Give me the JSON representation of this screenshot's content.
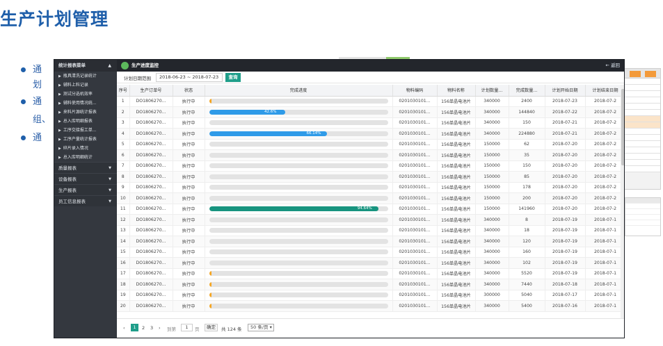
{
  "slide": {
    "title": "生产计划管理",
    "bullets": [
      {
        "prefix": "通"
      },
      {
        "prefix": "划"
      },
      {
        "prefix": "通"
      },
      {
        "prefix": "组、"
      },
      {
        "prefix": "通"
      }
    ]
  },
  "sidebar": {
    "header": "统计报表菜单",
    "items": [
      "瓶具清洗记录统计",
      "辅料上料记录",
      "测试分选机效率",
      "辅料使用情况统...",
      "来料片源统计报表",
      "总入库明细报表",
      "工序交接报工单...",
      "工序产量统计报表",
      "碎片录入情况",
      "总入库明细统计"
    ],
    "groups": [
      "质量报表",
      "设备报表",
      "生产报表",
      "员工信息报表"
    ]
  },
  "topbar": {
    "title": "生产进度监控",
    "back": "← 返回"
  },
  "filter": {
    "label": "计划日期范围",
    "range": "2018-06-23 ~ 2018-07-23",
    "button": "查询"
  },
  "table": {
    "columns": [
      "序号",
      "生产订单号",
      "状态",
      "完成进度",
      "物料编码",
      "物料名称",
      "计划数量...",
      "完成数量...",
      "计划开始日期",
      "计划结束日期"
    ],
    "rows": [
      {
        "no": "1",
        "order": "DO1806270...",
        "status": "执行中",
        "progress": 0.7,
        "progress_label": "",
        "material_code": "0201030101...",
        "material_name": "156单晶电池片",
        "plan_qty": "340000",
        "done_qty": "2400",
        "start": "2018-07-23",
        "end": "2018-07-2"
      },
      {
        "no": "2",
        "order": "DO1806270...",
        "status": "执行中",
        "progress": 42.6,
        "progress_label": "42.6%",
        "material_code": "0201030101...",
        "material_name": "156单晶电池片",
        "plan_qty": "340000",
        "done_qty": "144840",
        "start": "2018-07-22",
        "end": "2018-07-2"
      },
      {
        "no": "3",
        "order": "DO1806270...",
        "status": "执行中",
        "progress": 0.04,
        "progress_label": "",
        "material_code": "0201030101...",
        "material_name": "156单晶电池片",
        "plan_qty": "340000",
        "done_qty": "150",
        "start": "2018-07-21",
        "end": "2018-07-2"
      },
      {
        "no": "4",
        "order": "DO1806270...",
        "status": "执行中",
        "progress": 66.14,
        "progress_label": "66.14%",
        "material_code": "0201030101...",
        "material_name": "156单晶电池片",
        "plan_qty": "340000",
        "done_qty": "224880",
        "start": "2018-07-21",
        "end": "2018-07-2"
      },
      {
        "no": "5",
        "order": "DO1806270...",
        "status": "执行中",
        "progress": 0.04,
        "progress_label": "",
        "material_code": "0201030101...",
        "material_name": "156单晶电池片",
        "plan_qty": "150000",
        "done_qty": "62",
        "start": "2018-07-20",
        "end": "2018-07-2"
      },
      {
        "no": "6",
        "order": "DO1806270...",
        "status": "执行中",
        "progress": 0.02,
        "progress_label": "",
        "material_code": "0201030101...",
        "material_name": "156单晶电池片",
        "plan_qty": "150000",
        "done_qty": "35",
        "start": "2018-07-20",
        "end": "2018-07-2"
      },
      {
        "no": "7",
        "order": "DO1806270...",
        "status": "执行中",
        "progress": 0.1,
        "progress_label": "",
        "material_code": "0201030101...",
        "material_name": "156单晶电池片",
        "plan_qty": "150000",
        "done_qty": "150",
        "start": "2018-07-20",
        "end": "2018-07-2"
      },
      {
        "no": "8",
        "order": "DO1806270...",
        "status": "执行中",
        "progress": 0.06,
        "progress_label": "",
        "material_code": "0201030101...",
        "material_name": "156单晶电池片",
        "plan_qty": "150000",
        "done_qty": "85",
        "start": "2018-07-20",
        "end": "2018-07-2"
      },
      {
        "no": "9",
        "order": "DO1806270...",
        "status": "执行中",
        "progress": 0.12,
        "progress_label": "",
        "material_code": "0201030101...",
        "material_name": "156单晶电池片",
        "plan_qty": "150000",
        "done_qty": "178",
        "start": "2018-07-20",
        "end": "2018-07-2"
      },
      {
        "no": "10",
        "order": "DO1806270...",
        "status": "执行中",
        "progress": 0.13,
        "progress_label": "",
        "material_code": "0201030101...",
        "material_name": "156单晶电池片",
        "plan_qty": "150000",
        "done_qty": "200",
        "start": "2018-07-20",
        "end": "2018-07-2"
      },
      {
        "no": "11",
        "order": "DO1806270...",
        "status": "执行中",
        "progress": 94.64,
        "progress_label": "94.64%",
        "material_code": "0201030101...",
        "material_name": "156单晶电池片",
        "plan_qty": "150000",
        "done_qty": "141960",
        "start": "2018-07-20",
        "end": "2018-07-2"
      },
      {
        "no": "12",
        "order": "DO1806270...",
        "status": "执行中",
        "progress": 0.0,
        "progress_label": "",
        "material_code": "0201030101...",
        "material_name": "156单晶电池片",
        "plan_qty": "340000",
        "done_qty": "8",
        "start": "2018-07-19",
        "end": "2018-07-1"
      },
      {
        "no": "13",
        "order": "DO1806270...",
        "status": "执行中",
        "progress": 0.01,
        "progress_label": "",
        "material_code": "0201030101...",
        "material_name": "156单晶电池片",
        "plan_qty": "340000",
        "done_qty": "18",
        "start": "2018-07-19",
        "end": "2018-07-1"
      },
      {
        "no": "14",
        "order": "DO1806270...",
        "status": "执行中",
        "progress": 0.04,
        "progress_label": "",
        "material_code": "0201030101...",
        "material_name": "156单晶电池片",
        "plan_qty": "340000",
        "done_qty": "120",
        "start": "2018-07-19",
        "end": "2018-07-1"
      },
      {
        "no": "15",
        "order": "DO1806270...",
        "status": "执行中",
        "progress": 0.05,
        "progress_label": "",
        "material_code": "0201030101...",
        "material_name": "156单晶电池片",
        "plan_qty": "340000",
        "done_qty": "160",
        "start": "2018-07-19",
        "end": "2018-07-1"
      },
      {
        "no": "16",
        "order": "DO1806270...",
        "status": "执行中",
        "progress": 0.03,
        "progress_label": "",
        "material_code": "0201030101...",
        "material_name": "156单晶电池片",
        "plan_qty": "340000",
        "done_qty": "102",
        "start": "2018-07-19",
        "end": "2018-07-1"
      },
      {
        "no": "17",
        "order": "DO1806270...",
        "status": "执行中",
        "progress": 1.62,
        "progress_label": "",
        "material_code": "0201030101...",
        "material_name": "156单晶电池片",
        "plan_qty": "340000",
        "done_qty": "5520",
        "start": "2018-07-19",
        "end": "2018-07-1"
      },
      {
        "no": "18",
        "order": "DO1806270...",
        "status": "执行中",
        "progress": 2.19,
        "progress_label": "",
        "material_code": "0201030101...",
        "material_name": "156单晶电池片",
        "plan_qty": "340000",
        "done_qty": "7440",
        "start": "2018-07-18",
        "end": "2018-07-1"
      },
      {
        "no": "19",
        "order": "DO1806270...",
        "status": "执行中",
        "progress": 1.68,
        "progress_label": "",
        "material_code": "0201030101...",
        "material_name": "156单晶电池片",
        "plan_qty": "300000",
        "done_qty": "5040",
        "start": "2018-07-17",
        "end": "2018-07-1"
      },
      {
        "no": "20",
        "order": "DO1806270...",
        "status": "执行中",
        "progress": 1.59,
        "progress_label": "",
        "material_code": "0201030101...",
        "material_name": "156单晶电池片",
        "plan_qty": "340000",
        "done_qty": "5400",
        "start": "2018-07-16",
        "end": "2018-07-1"
      }
    ]
  },
  "pager": {
    "prev": "‹",
    "pages": [
      "1",
      "2",
      "3"
    ],
    "next": "›",
    "goto_label": "到第",
    "goto_value": "1",
    "page_unit": "页",
    "confirm": "确定",
    "total": "共 124 条",
    "page_size": "50 条/页 ▾"
  },
  "colors": {
    "title_blue": "#1f5faa",
    "progress_blue": "#2f9be8",
    "progress_teal": "#17947f",
    "progress_orange": "#f5a623",
    "progress_gray": "#d8d8d8"
  }
}
